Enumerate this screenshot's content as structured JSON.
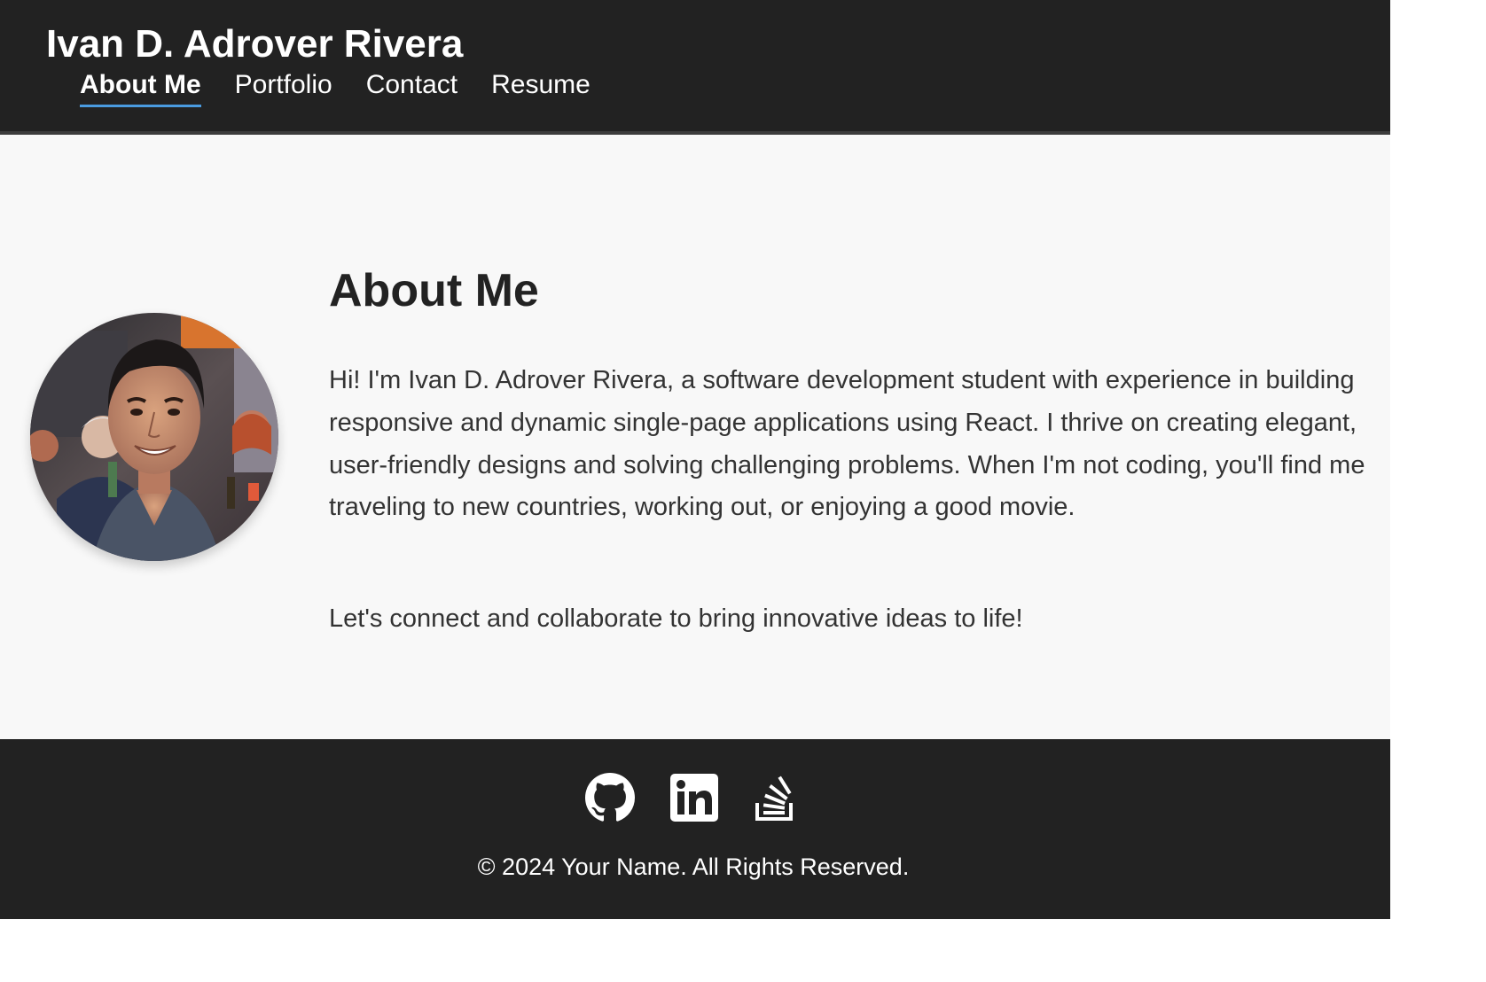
{
  "header": {
    "site_title": "Ivan D. Adrover Rivera",
    "nav": [
      {
        "label": "About Me",
        "active": true
      },
      {
        "label": "Portfolio",
        "active": false
      },
      {
        "label": "Contact",
        "active": false
      },
      {
        "label": "Resume",
        "active": false
      }
    ]
  },
  "about": {
    "heading": "About Me",
    "bio": "Hi! I'm Ivan D. Adrover Rivera, a software development student with experience in building responsive and dynamic single-page applications using React. I thrive on creating elegant, user-friendly designs and solving challenging problems. When I'm not coding, you'll find me traveling to new countries, working out, or enjoying a good movie.",
    "call_to_action": "Let's connect and collaborate to bring innovative ideas to life!",
    "avatar": "profile-photo"
  },
  "footer": {
    "social": [
      {
        "icon": "github-icon"
      },
      {
        "icon": "linkedin-icon"
      },
      {
        "icon": "stackoverflow-icon"
      }
    ],
    "copyright": "© 2024 Your Name. All Rights Reserved."
  },
  "colors": {
    "header_bg": "#222222",
    "page_bg": "#f8f8f8",
    "active_underline": "#4a9be0",
    "text": "#222222"
  }
}
